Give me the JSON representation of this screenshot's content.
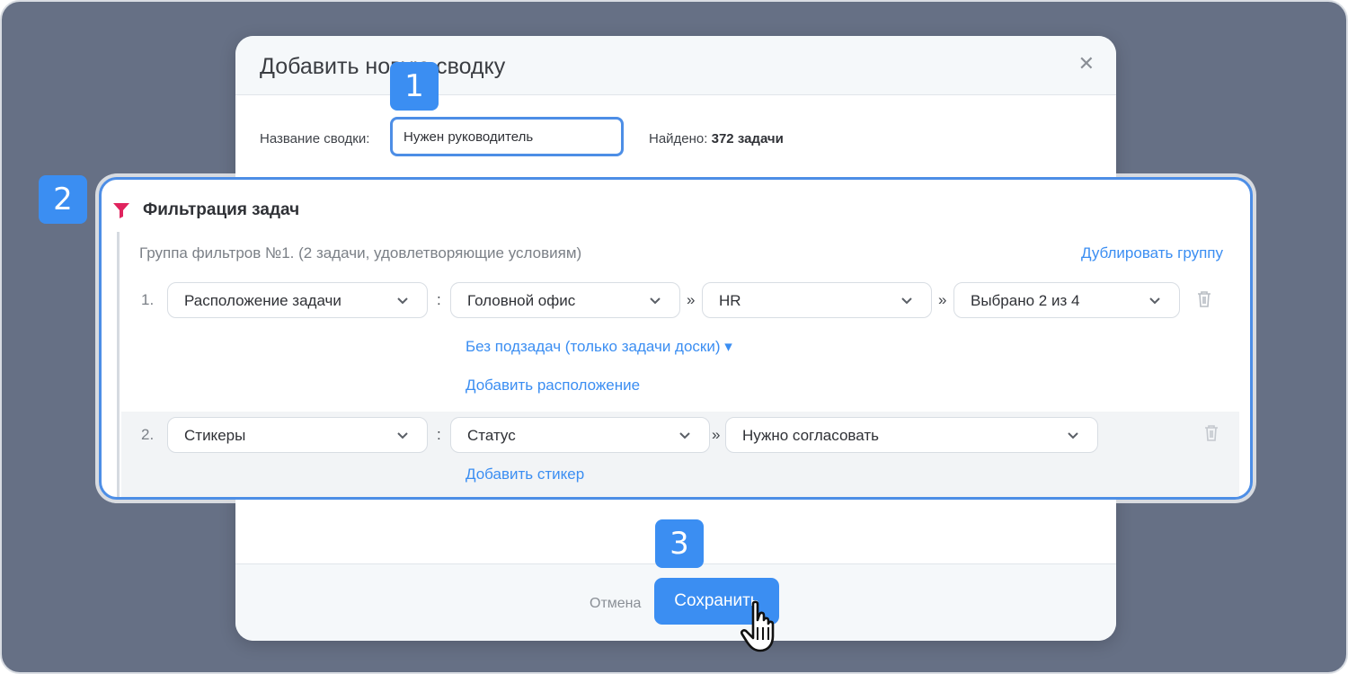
{
  "modal": {
    "title": "Добавить новую сводку",
    "close_icon": "close-icon",
    "name_label": "Название сводки:",
    "name_value": "Нужен руководитель",
    "found_label": "Найдено:",
    "found_value": "372 задачи"
  },
  "filter": {
    "title": "Фильтрация задач",
    "icon": "funnel-icon",
    "group_title": "Группа фильтров №1. (2 задачи, удовлетворяющие условиям)",
    "duplicate_link": "Дублировать группу",
    "rows": [
      {
        "number": "1.",
        "field": "Расположение задачи",
        "sep1": ":",
        "value1": "Головной офис",
        "sep2": "»",
        "value2": "HR",
        "sep3": "»",
        "value3": "Выбрано 2 из 4",
        "subtasks_link": "Без подзадач (только задачи доски) ▾",
        "add_link": "Добавить расположение"
      },
      {
        "number": "2.",
        "field": "Стикеры",
        "sep1": ":",
        "value1": "Статус",
        "sep2": "»",
        "value2": "Нужно согласовать",
        "add_link": "Добавить стикер"
      }
    ]
  },
  "footer": {
    "cancel_label": "Отмена",
    "save_label": "Сохранить"
  },
  "badges": [
    "1",
    "2",
    "3"
  ],
  "colors": {
    "accent": "#3b8ef2",
    "backdrop": "#667085",
    "funnel": "#e0245e"
  }
}
